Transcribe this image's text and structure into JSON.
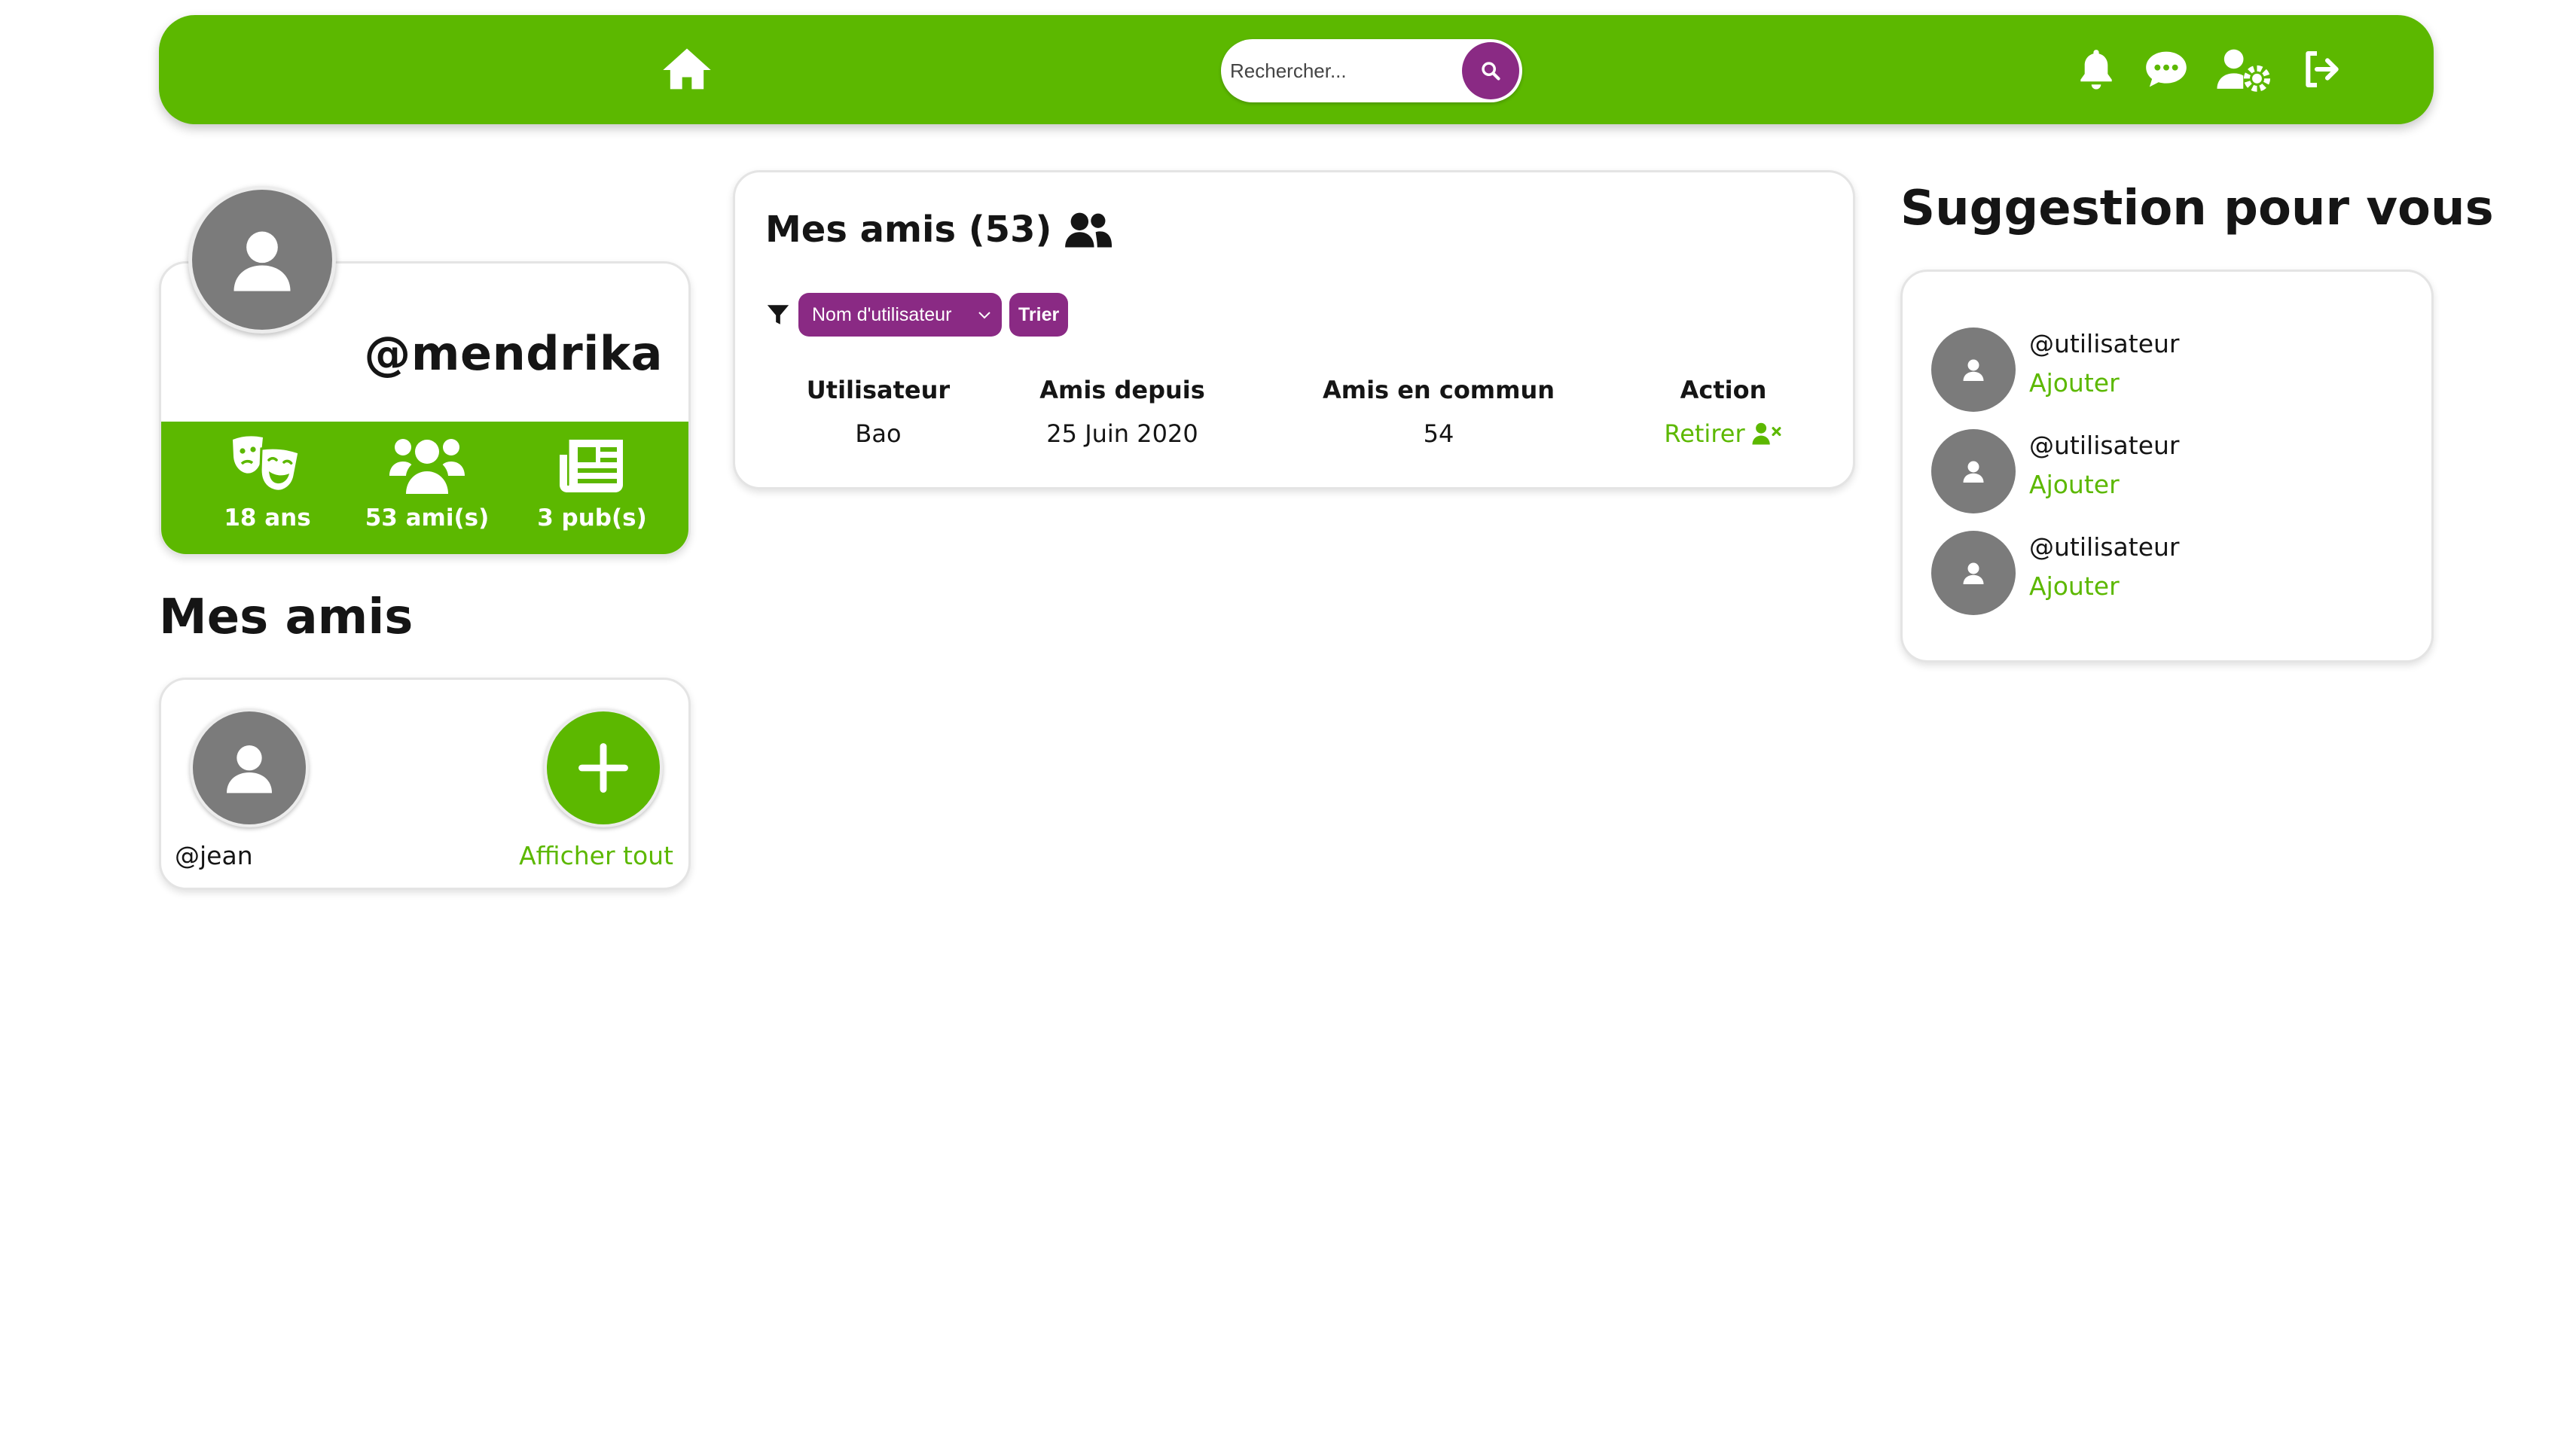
{
  "colors": {
    "brand_green": "#5cb800",
    "accent_purple": "#8a2a84",
    "avatar_gray": "#7b7b7b"
  },
  "navbar": {
    "search": {
      "placeholder": "Rechercher..."
    },
    "icons": [
      "home-icon",
      "search-icon",
      "bell-icon",
      "chat-icon",
      "user-settings-icon",
      "logout-icon"
    ]
  },
  "profile": {
    "username": "@mendrika",
    "stats": [
      {
        "icon": "masks-icon",
        "label": "18 ans"
      },
      {
        "icon": "users-icon",
        "label": "53 ami(s)"
      },
      {
        "icon": "newspaper-icon",
        "label": "3 pub(s)"
      }
    ]
  },
  "friends_section": {
    "heading": "Mes amis",
    "friend": {
      "name": "@jean"
    },
    "show_all_label": "Afficher tout"
  },
  "main": {
    "title": "Mes amis (53)",
    "filter": {
      "select_value": "Nom d'utilisateur",
      "sort_label": "Trier"
    },
    "table": {
      "headers": [
        "Utilisateur",
        "Amis depuis",
        "Amis en commun",
        "Action"
      ],
      "rows": [
        {
          "user": "Bao",
          "since": "25 Juin 2020",
          "common": "54",
          "action": "Retirer"
        }
      ]
    }
  },
  "suggestions": {
    "heading": "Suggestion pour vous",
    "items": [
      {
        "name": "@utilisateur",
        "action": "Ajouter"
      },
      {
        "name": "@utilisateur",
        "action": "Ajouter"
      },
      {
        "name": "@utilisateur",
        "action": "Ajouter"
      }
    ]
  }
}
